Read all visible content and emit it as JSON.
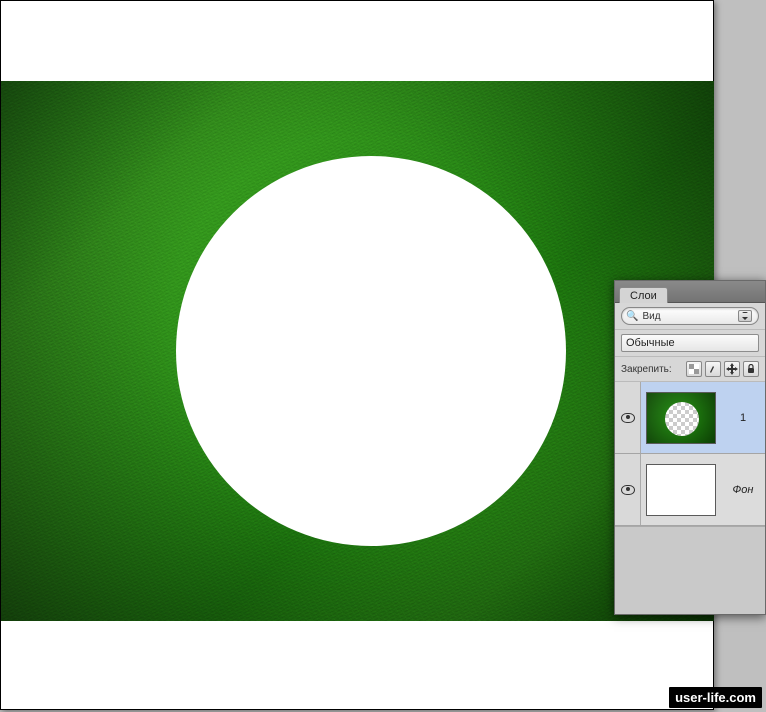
{
  "panel": {
    "tab_label": "Слои",
    "search_label": "Вид",
    "blend_mode": "Обычные",
    "lock_label": "Закрепить:"
  },
  "layers": [
    {
      "name": "1",
      "visible": true,
      "selected": true,
      "type": "grass-hole"
    },
    {
      "name": "Фон",
      "visible": true,
      "selected": false,
      "type": "white"
    }
  ],
  "watermark": "user-life.com"
}
